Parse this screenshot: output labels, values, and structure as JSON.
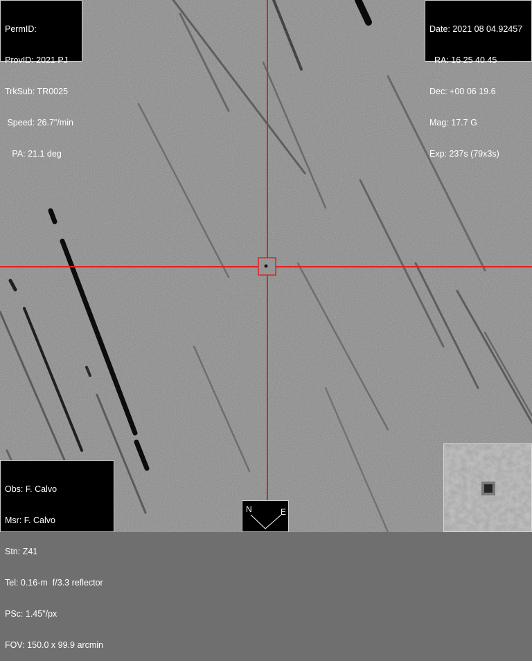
{
  "top_left": {
    "permid": "PermID:",
    "provid": "ProvID: 2021 PJ",
    "trksub": "TrkSub: TR0025",
    "speed": " Speed: 26.7\"/min",
    "pa": "   PA: 21.1 deg"
  },
  "top_right": {
    "date": "Date: 2021 08 04.92457",
    "ra": "  RA: 16 25 40.45",
    "dec": "Dec: +00 06 19.6",
    "mag": "Mag: 17.7 G",
    "exp": "Exp: 237s (79x3s)"
  },
  "bottom_left": {
    "obs": "Obs: F. Calvo",
    "msr": "Msr: F. Calvo",
    "stn": "Stn: Z41",
    "tel": "Tel: 0.16-m  f/3.3 reflector",
    "psc": "PSc: 1.45\"/px",
    "fov": "FOV: 150.0 x 99.9 arcmin"
  },
  "compass": {
    "north": "N",
    "east": "E"
  },
  "colors": {
    "crosshair": "#e02020",
    "background": "#6f6f6f",
    "streak": "#1a1a1a"
  }
}
